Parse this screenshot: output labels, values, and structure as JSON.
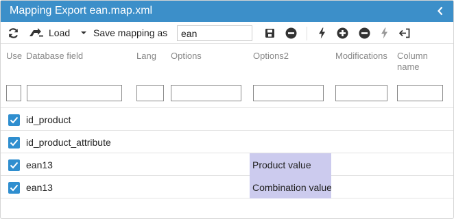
{
  "title": "Mapping Export ean.map.xml",
  "toolbar": {
    "load_label": "Load",
    "save_mapping_label": "Save mapping as",
    "mapping_name_value": "ean"
  },
  "columns": {
    "use": "Use",
    "database_field": "Database field",
    "lang": "Lang",
    "options": "Options",
    "options2": "Options2",
    "modifications": "Modifications",
    "column_name_line1": "Column",
    "column_name_line2": "name"
  },
  "rows": [
    {
      "checked": true,
      "field": "id_product",
      "options2": ""
    },
    {
      "checked": true,
      "field": "id_product_attribute",
      "options2": ""
    },
    {
      "checked": true,
      "field": "ean13",
      "options2": "Product value"
    },
    {
      "checked": true,
      "field": "ean13",
      "options2": "Combination value"
    }
  ],
  "colors": {
    "title_bar": "#3c8fc9",
    "checkbox": "#2f8ecf",
    "options2_highlight": "#cccbee"
  },
  "icons": [
    "refresh-icon",
    "load-icon",
    "caret-down-icon",
    "save-icon",
    "minus-circle-icon",
    "bolt-icon",
    "plus-circle-icon",
    "minus-circle-icon",
    "bolt-icon",
    "sign-in-icon",
    "chevron-left-icon",
    "check-icon"
  ]
}
